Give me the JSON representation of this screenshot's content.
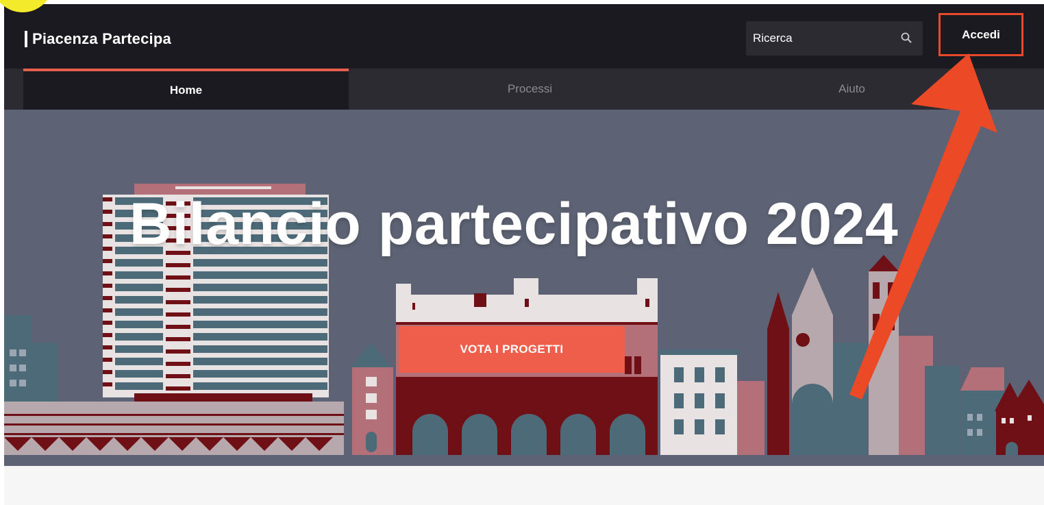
{
  "header": {
    "brand": "Piacenza Partecipa",
    "search_placeholder": "Ricerca",
    "login_label": "Accedi"
  },
  "nav": {
    "tabs": [
      {
        "label": "Home",
        "active": true
      },
      {
        "label": "Processi",
        "active": false
      },
      {
        "label": "Aiuto",
        "active": false
      }
    ]
  },
  "hero": {
    "title": "Bilancio partecipativo 2024",
    "cta_label": "VOTA I PROGETTI"
  },
  "annotation": {
    "highlight_color": "#e8492b",
    "arrow_color": "#ec4a26"
  },
  "colors": {
    "topbar": "#1b1a20",
    "navbar": "#2c2b32",
    "accent": "#ef5e4a",
    "hero_bg": "#5d6374",
    "dark_red": "#6e1016",
    "slate": "#4d6a78"
  }
}
